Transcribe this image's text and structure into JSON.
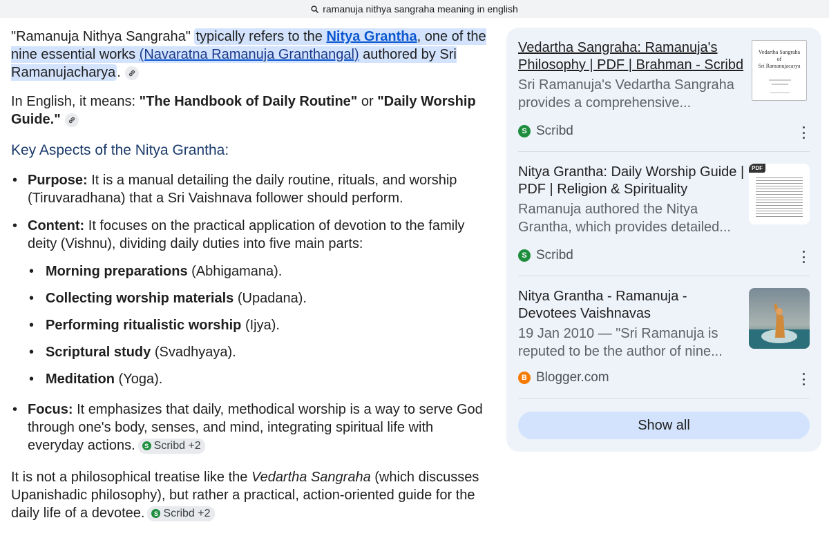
{
  "search": {
    "query": "ramanuja nithya sangraha meaning in english"
  },
  "answer": {
    "intro": {
      "plain_before": "\"Ramanuja Nithya Sangraha\" ",
      "hl_1": "typically refers to the ",
      "link_1": "Nitya Grantha",
      "hl_2": ", one of the nine essential works ",
      "link_2": "(Navaratna Ramanuja Granthangal)",
      "hl_3": " authored by Sri Ramanujacharya",
      "end": "."
    },
    "meaning": {
      "before": "In English, it means: ",
      "term1": "\"The Handbook of Daily Routine\"",
      "mid": " or ",
      "term2": "\"Daily Worship Guide.\""
    },
    "section_heading": "Key Aspects of the Nitya Grantha:",
    "bullets": {
      "purpose_label": "Purpose:",
      "purpose_text": " It is a manual detailing the daily routine, rituals, and worship (Tiruvaradhana) that a Sri Vaishnava follower should perform.",
      "content_label": "Content:",
      "content_text": " It focuses on the practical application of devotion to the family deity (Vishnu), dividing daily duties into five main parts:",
      "parts": [
        {
          "bold": "Morning preparations",
          "rest": " (Abhigamana)."
        },
        {
          "bold": "Collecting worship materials",
          "rest": " (Upadana)."
        },
        {
          "bold": "Performing ritualistic worship",
          "rest": " (Ijya)."
        },
        {
          "bold": "Scriptural study",
          "rest": " (Svadhyaya)."
        },
        {
          "bold": "Meditation",
          "rest": " (Yoga)."
        }
      ],
      "focus_label": "Focus:",
      "focus_text": " It emphasizes that daily, methodical worship is a way to serve God through one's body, senses, and mind, integrating spiritual life with everyday actions.",
      "focus_chip": "Scribd +2"
    },
    "closing": {
      "before": "It is not a philosophical treatise like the ",
      "italic": "Vedartha Sangraha",
      "after": " (which discusses Upanishadic philosophy), but rather a practical, action-oriented guide for the daily life of a devotee.",
      "chip": "Scribd +2"
    }
  },
  "sources": {
    "cards": [
      {
        "title": "Vedartha Sangraha: Ramanuja's Philosophy | PDF | Brahman - Scribd",
        "snippet": "Sri Ramanuja's Vedartha Sangraha provides a comprehensive...",
        "site": "Scribd",
        "thumb_text": [
          "Vedartha Sangraha",
          "of",
          "Sri Ramanujacarya"
        ]
      },
      {
        "title": "Nitya Grantha: Daily Worship Guide | PDF | Religion & Spirituality",
        "snippet": "Ramanuja authored the Nitya Grantha, which provides detailed...",
        "site": "Scribd",
        "thumb_badge": "PDF"
      },
      {
        "title": "Nitya Grantha - Ramanuja - Devotees Vaishnavas",
        "snippet": "19 Jan 2010 — \"Sri Ramanuja is reputed to be the author of nine...",
        "site": "Blogger.com"
      }
    ],
    "show_all": "Show all"
  },
  "colors": {
    "highlight": "#d3e3fd",
    "link": "#0b57d0",
    "panel_bg": "#eef2f9",
    "scribd": "#1e8e3e",
    "blogger": "#f57c00"
  }
}
